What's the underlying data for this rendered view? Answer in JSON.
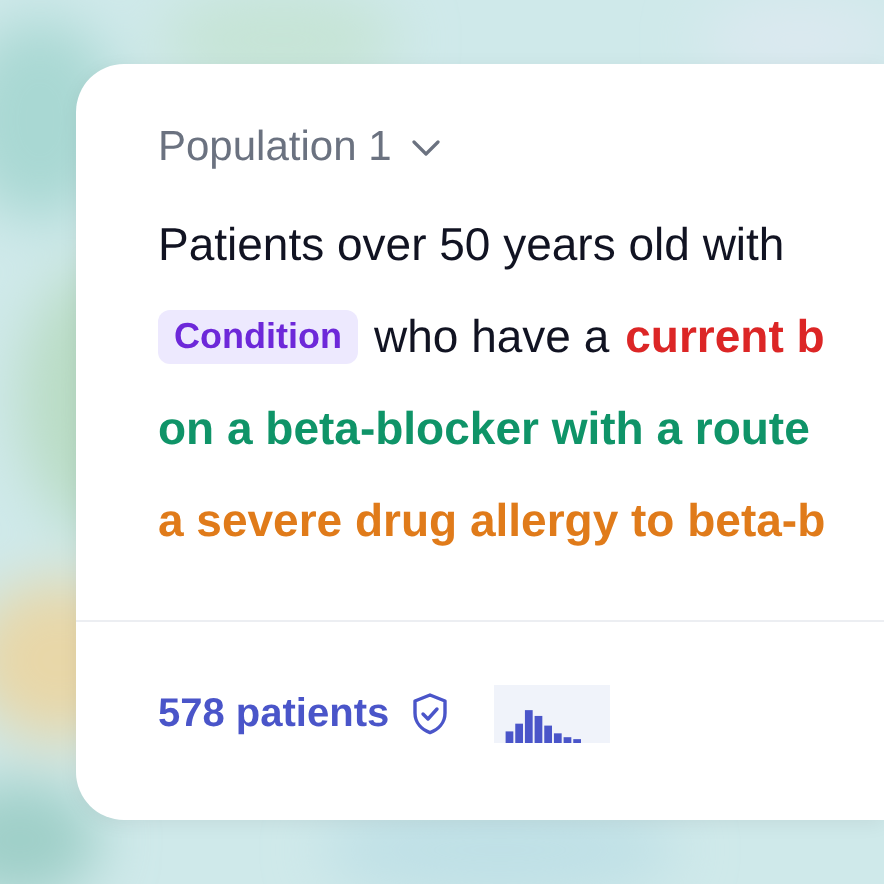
{
  "card": {
    "title": "Population 1",
    "lines": [
      {
        "segments": [
          {
            "kind": "text",
            "text": "Patients over 50 years old with"
          }
        ]
      },
      {
        "segments": [
          {
            "kind": "chip",
            "text": "Condition"
          },
          {
            "kind": "text",
            "text": "who have a"
          },
          {
            "kind": "colored",
            "text": "current b",
            "color": "#dc2626"
          }
        ]
      },
      {
        "segments": [
          {
            "kind": "colored",
            "text": "on a beta-blocker with a route",
            "color": "#0f9468"
          }
        ]
      },
      {
        "segments": [
          {
            "kind": "colored",
            "text": "a severe drug allergy to beta-b",
            "color": "#e07b1a"
          }
        ]
      }
    ],
    "footer": {
      "count": "578 patients"
    }
  }
}
